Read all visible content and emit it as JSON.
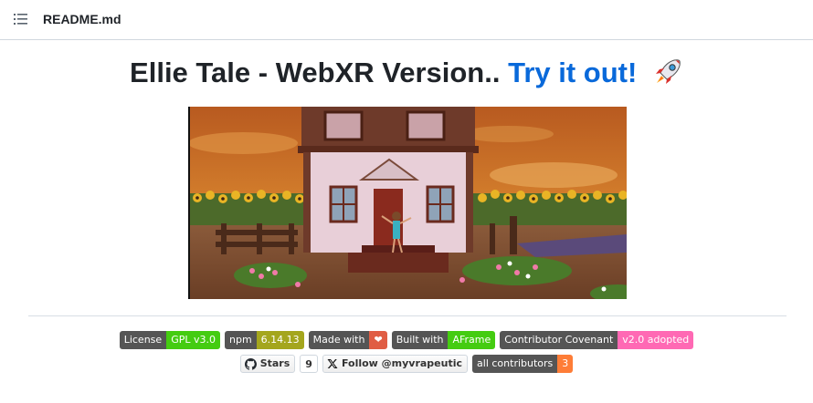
{
  "header": {
    "file_name": "README.md",
    "menu_icon": "list-icon"
  },
  "title": {
    "text": "Ellie Tale - WebXR Version..",
    "link_text": "Try it out!",
    "emoji_icon": "rocket-icon"
  },
  "hero_image": {
    "description_icon": "game-screenshot"
  },
  "badges_row1": [
    {
      "label": "License",
      "value": "GPL v3.0",
      "color": "#4c1"
    },
    {
      "label": "npm",
      "value": "6.14.13",
      "color": "#a4a61d"
    },
    {
      "label": "Made with",
      "value": "❤",
      "color": "#e05d44"
    },
    {
      "label": "Built with",
      "value": "AFrame",
      "color": "#4c1"
    },
    {
      "label": "Contributor Covenant",
      "value": "v2.0 adopted",
      "color": "#ff69b4"
    }
  ],
  "badges_row2": {
    "stars": {
      "label": "Stars",
      "count": "9"
    },
    "follow": {
      "label": "Follow @myvrapeutic"
    },
    "contributors": {
      "label": "all contributors",
      "value": "3",
      "color": "#fe7d37"
    }
  }
}
